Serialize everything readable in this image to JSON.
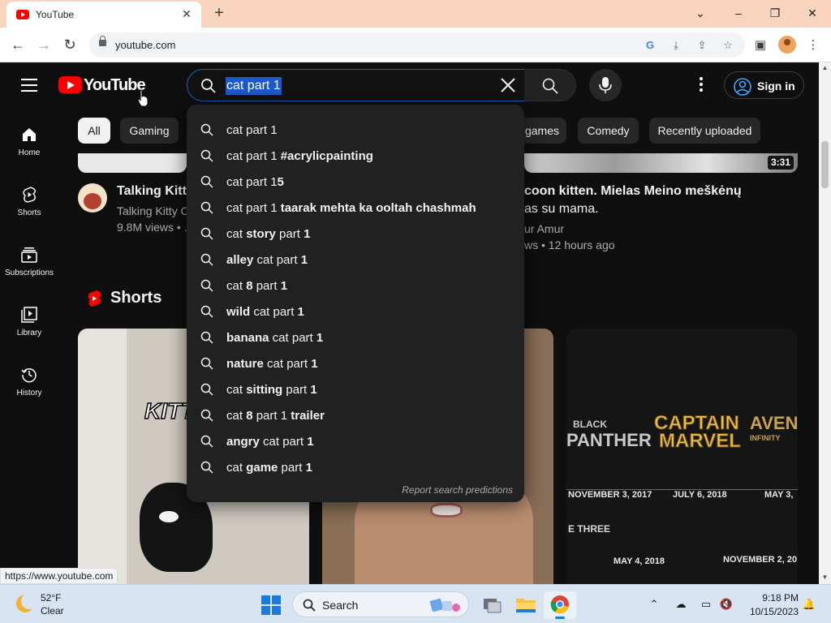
{
  "browser": {
    "tab_title": "YouTube",
    "url": "youtube.com",
    "status_url": "https://www.youtube.com"
  },
  "header": {
    "logo_text": "YouTube",
    "search_query": "cat part 1",
    "sign_in": "Sign in"
  },
  "guide": [
    {
      "label": "Home",
      "icon": "home-icon"
    },
    {
      "label": "Shorts",
      "icon": "shorts-icon"
    },
    {
      "label": "Subscriptions",
      "icon": "subscriptions-icon"
    },
    {
      "label": "Library",
      "icon": "library-icon"
    },
    {
      "label": "History",
      "icon": "history-icon"
    }
  ],
  "chips": [
    "All",
    "Gaming",
    "games",
    "Comedy",
    "Recently uploaded"
  ],
  "videos": {
    "left": {
      "title": "Talking Kitty",
      "channel": "Talking Kitty C",
      "meta": "9.8M views • ."
    },
    "right": {
      "title_line1": "coon kitten. Mielas Meino meškėnų",
      "title_line2": "as su mama.",
      "channel": "ur Amur",
      "meta": "ws • 12 hours ago",
      "duration": "3:31"
    }
  },
  "shorts": {
    "heading": "Shorts",
    "card1_overlay": "KITT",
    "card3_movies": [
      {
        "title_a": "BLACK",
        "title_b": "PANTHER",
        "date": "NOVEMBER 3, 2017"
      },
      {
        "title_a": "CAPTAIN",
        "title_b": "MARVEL",
        "date": "JULY 6, 2018"
      },
      {
        "title_a": "AVEN",
        "title_b": "INFINITY",
        "date": "MAY 3,"
      }
    ],
    "card3_section": "E THREE",
    "card3_dates_lower": [
      "MAY 4, 2018",
      "NOVEMBER 2, 20"
    ]
  },
  "suggestions": [
    {
      "pre": "cat part 1",
      "bold": ""
    },
    {
      "pre": "cat part 1 ",
      "bold": "#acrylicpainting"
    },
    {
      "pre": "cat part 1",
      "bold": "5"
    },
    {
      "pre": "cat part 1 ",
      "bold": "taarak mehta ka ooltah chashmah"
    },
    {
      "html": "cat <b>story</b> part <b>1</b>"
    },
    {
      "html": "<b>alley</b> cat part <b>1</b>"
    },
    {
      "html": "cat <b>8</b> part <b>1</b>"
    },
    {
      "html": "<b>wild</b> cat part <b>1</b>"
    },
    {
      "html": "<b>banana</b> cat part <b>1</b>"
    },
    {
      "html": "<b>nature</b> cat part <b>1</b>"
    },
    {
      "html": "cat <b>sitting</b> part <b>1</b>"
    },
    {
      "html": "cat <b>8</b> part 1 <b>trailer</b>"
    },
    {
      "html": "<b>angry</b> cat part <b>1</b>"
    },
    {
      "html": "cat <b>game</b> part <b>1</b>"
    }
  ],
  "report_link": "Report search predictions",
  "taskbar": {
    "temperature": "52°F",
    "condition": "Clear",
    "search_label": "Search",
    "time": "9:18 PM",
    "date": "10/15/2023"
  }
}
